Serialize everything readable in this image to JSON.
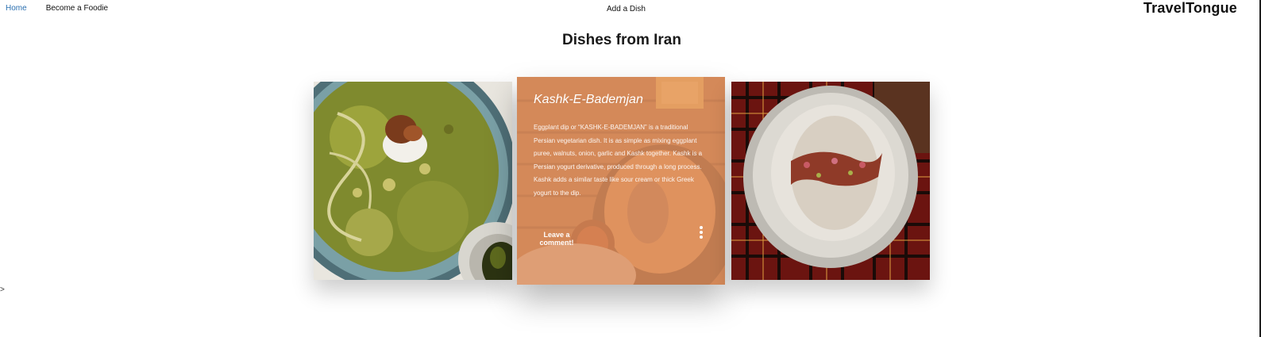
{
  "nav": {
    "home_label": "Home",
    "foodie_label": "Become a Foodie",
    "add_dish_label": "Add a Dish",
    "brand": "TravelTongue"
  },
  "page": {
    "title": "Dishes from Iran",
    "side_arrow": ">"
  },
  "cards": [
    {
      "kind": "image",
      "image": "bowl of green herb noodle soup"
    },
    {
      "kind": "featured",
      "image": "platter of eggplant dip with bread and dishes",
      "name": "Kashk-E-Bademjan",
      "description": "Eggplant dip or “KASHK-E-BADEMJAN” is a traditional Persian vegetarian dish. It is as simple as mixing eggplant puree, walnuts, onion, garlic and Kashk together. Kashk is a Persian yogurt derivative, produced through a long process. Kashk adds a similar taste like sour cream or thick Greek yogurt to the dip.",
      "comment_label": "Leave a comment!",
      "more_icon": "more-vertical-icon"
    },
    {
      "kind": "image",
      "image": "plate of creamy dip topped with nuts and rose petals on plaid cloth"
    }
  ],
  "colors": {
    "link_active": "#2a6fb0",
    "overlay": "#e89664"
  }
}
